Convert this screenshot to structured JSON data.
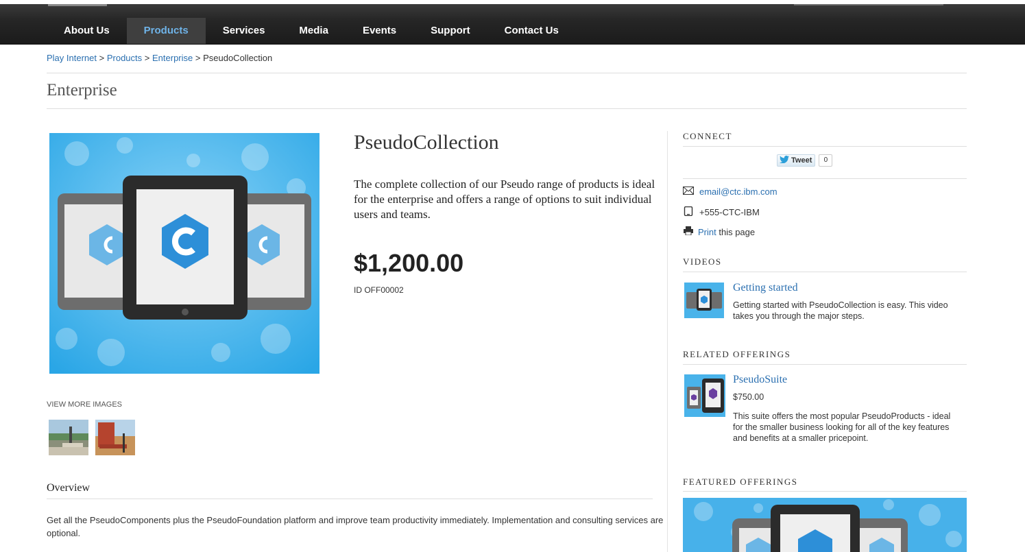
{
  "nav": {
    "items": [
      "About Us",
      "Products",
      "Services",
      "Media",
      "Events",
      "Support",
      "Contact Us"
    ],
    "active": "Products"
  },
  "breadcrumb": {
    "crumb1": "Play Internet",
    "crumb2": "Products",
    "crumb3": "Enterprise",
    "current": "PseudoCollection",
    "separator": ">"
  },
  "page": {
    "title": "Enterprise"
  },
  "product": {
    "name": "PseudoCollection",
    "description": "The complete collection of our Pseudo range of products is ideal for the enterprise and offers a range of options to suit individual users and teams.",
    "price": "$1,200.00",
    "id": "ID OFF00002",
    "view_more_label": "VIEW MORE IMAGES",
    "overview_heading": "Overview",
    "overview_text": "Get all the PseudoComponents plus the PseudoFoundation platform and improve team productivity immediately. Implementation and consulting services are optional."
  },
  "sidebar": {
    "connect": {
      "heading": "CONNECT",
      "tweet_label": "Tweet",
      "tweet_count": "0",
      "email": "email@ctc.ibm.com",
      "phone": "+555-CTC-IBM",
      "print_link": "Print",
      "print_suffix": " this page"
    },
    "videos": {
      "heading": "VIDEOS",
      "title": "Getting started",
      "text": "Getting started with PseudoCollection is easy. This video takes you through the major steps."
    },
    "related": {
      "heading": "RELATED OFFERINGS",
      "title": "PseudoSuite",
      "price": "$750.00",
      "text": "This suite offers the most popular PseudoProducts - ideal for the smaller business looking for all of the key features and benefits at a smaller pricepoint."
    },
    "featured": {
      "heading": "FEATURED OFFERINGS"
    }
  },
  "colors": {
    "nav_bg": "#222222",
    "nav_active_text": "#6fb3e8",
    "link": "#2a6fb0",
    "image_bg": "#4fb8ec",
    "logo_blue": "#2d8fd8"
  },
  "icons": [
    "email-icon",
    "phone-icon",
    "print-icon",
    "twitter-bird-icon"
  ]
}
